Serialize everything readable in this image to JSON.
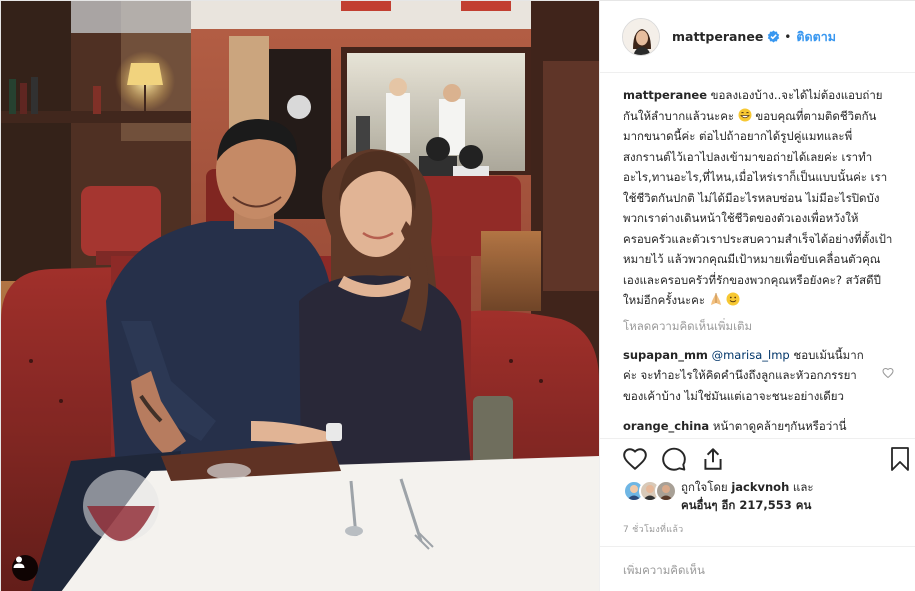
{
  "post": {
    "username": "mattperanee",
    "follow_label": "ติดตาม",
    "separator": "•",
    "caption_text": " ขอลงเองบ้าง..จะได้ไม่ต้องแอบถ่ายกันให้ลำบากแล้วนะคะ",
    "caption_text_2": " ขอบคุณที่ตามติดชีวิตกันมากขนาดนี้ค่ะ ต่อไปถ้าอยากได้รูปคู่แมทและพี่สงกรานต์ไว้เอาไปลงเข้ามาขอถ่ายได้เลยค่ะ เราทำอะไร,ทานอะไร,ที่ไหน,เมื่อไหร่เราก็เป็นแบบนั้นค่ะ เราใช้ชีวิตกันปกติ ไม่ได้มีอะไรหลบซ่อน ไม่มีอะไรปิดบัง พวกเราต่างเดินหน้าใช้ชีวิตของตัวเองเพื่อหวังให้ครอบครัวและตัวเราประสบความสำเร็จได้อย่างที่ตั้งเป้าหมายไว้ แล้วพวกคุณมีเป้าหมายเพื่อขับเคลื่อนตัวคุณเองและครอบครัวที่รักของพวกคุณหรือยังคะ? สวัสดีปีใหม่อีกครั้งนะคะ",
    "load_more": "โหลดความคิดเห็นเพิ่มเติม",
    "comments": [
      {
        "username": "supapan_mm",
        "mention": "@marisa_lmp",
        "text": " ชอบเม้นนี้มากค่ะ จะทำอะไรให้คิดคำนึงถึงลูกและหัวอกภรรยาของเค้าบ้าง ไม่ใช่มันแต่เอาจะชนะอย่างเดียว"
      },
      {
        "username": "orange_china",
        "text": " หน้าตาดูคล้ายๆกันหรือว่านี่"
      }
    ],
    "likes_prefix": "ถูกใจโดย ",
    "likes_user": "jackvnoh",
    "likes_middle": " และ",
    "likes_others": "คนอื่นๆ อีก 217,553 คน",
    "timestamp": "7 ชั่วโมงที่แล้ว",
    "add_comment_placeholder": "เพิ่มความคิดเห็น"
  },
  "colors": {
    "accent_blue": "#3897f0",
    "verified_blue": "#3897f0",
    "mention_blue": "#003569",
    "muted_gray": "#999999",
    "border": "#efefef"
  },
  "icons": {
    "like": "heart-icon",
    "comment": "comment-bubble-icon",
    "share": "share-icon",
    "save": "bookmark-icon",
    "verified": "verified-badge-icon",
    "user_tag": "user-tag-icon"
  }
}
